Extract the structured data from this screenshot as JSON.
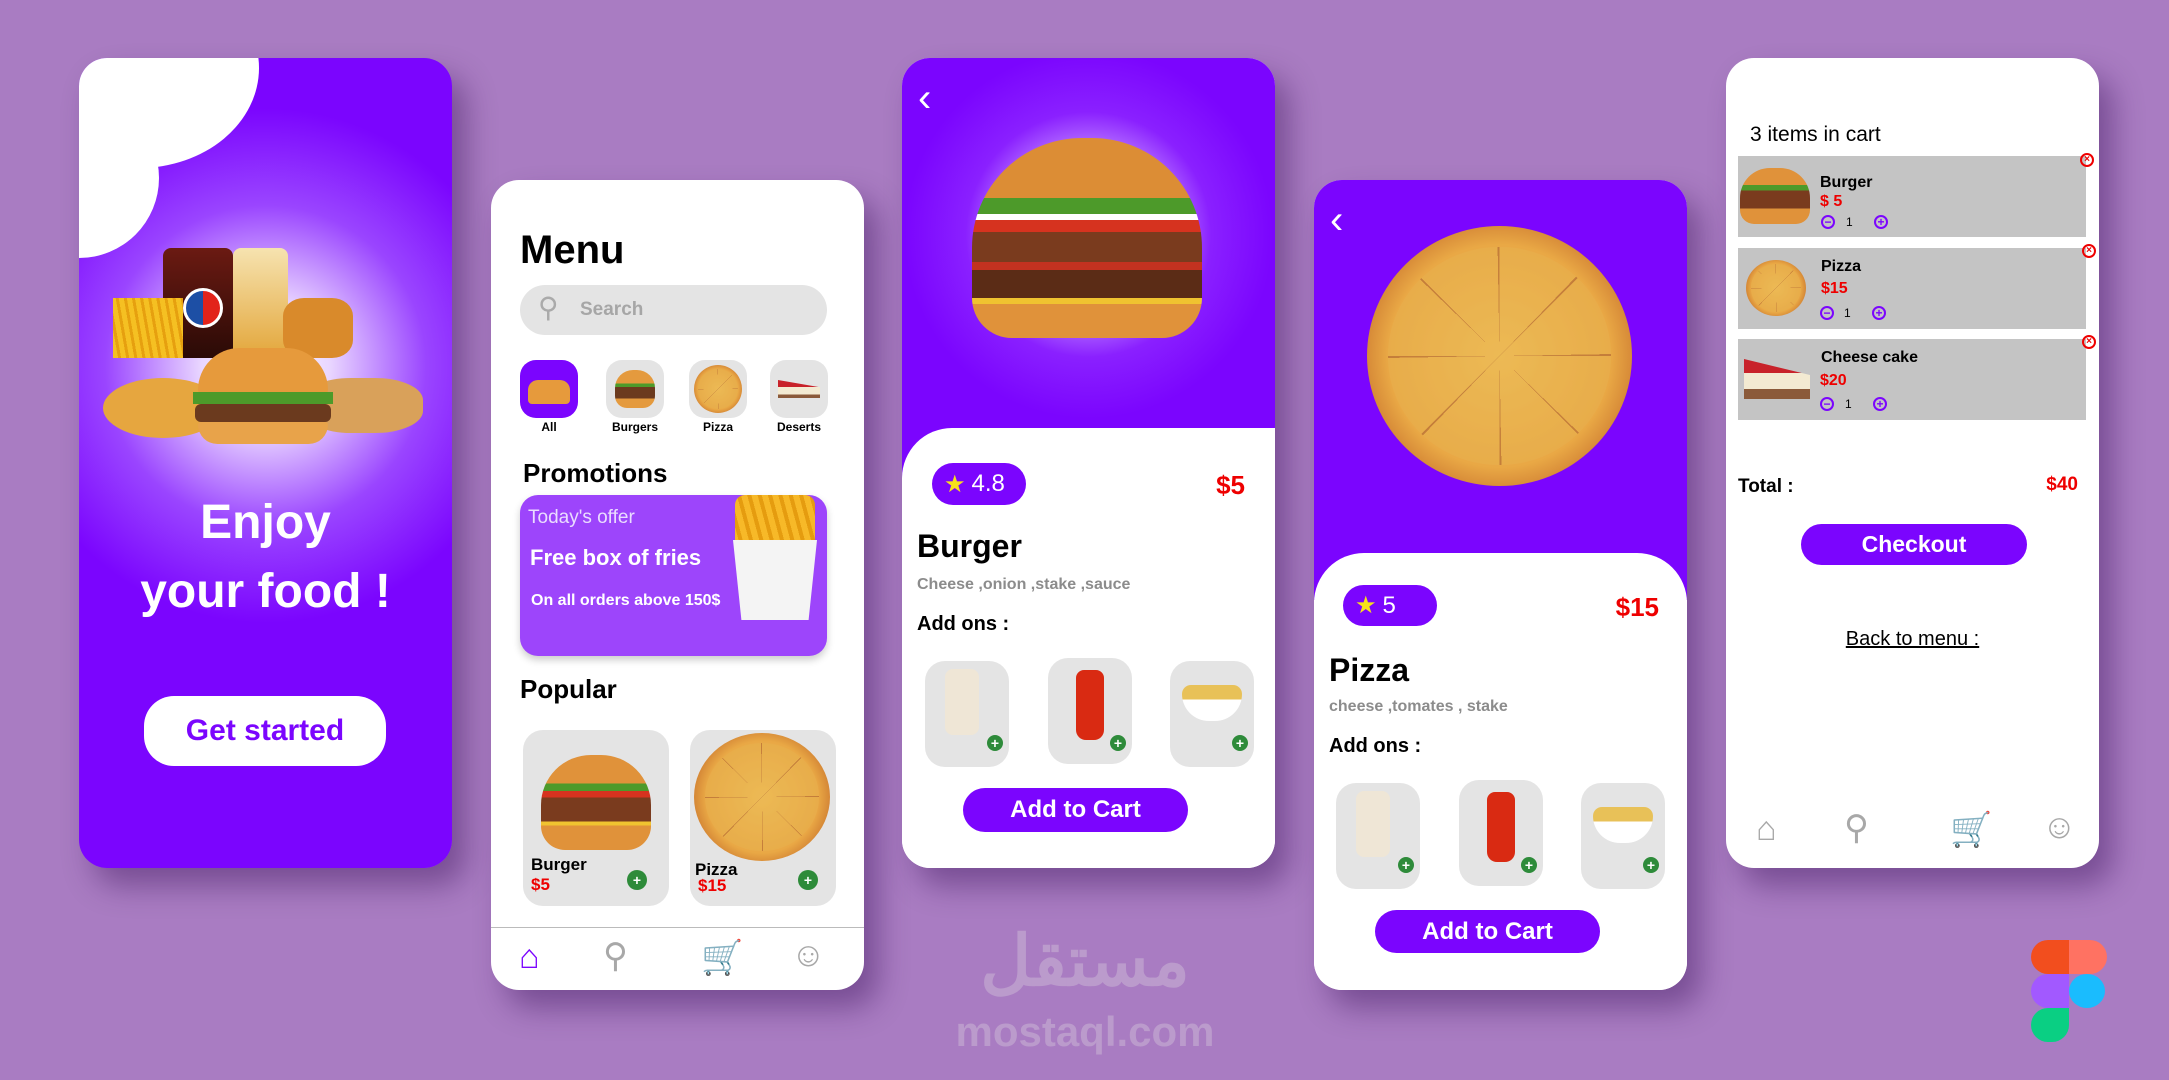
{
  "colors": {
    "background": "#a97cc2",
    "accent": "#7b05fe",
    "price": "#ee0000",
    "add": "#2e8b3a"
  },
  "welcome": {
    "title_line1": "Enjoy",
    "title_line2": "your food !",
    "button": "Get started"
  },
  "menu": {
    "title": "Menu",
    "search_placeholder": "Search",
    "categories": [
      {
        "label": "All"
      },
      {
        "label": "Burgers"
      },
      {
        "label": "Pizza"
      },
      {
        "label": "Deserts"
      }
    ],
    "promotions_title": "Promotions",
    "promo": {
      "kicker": "Today's offer",
      "headline": "Free box of fries",
      "detail": "On all orders above 150$"
    },
    "popular_title": "Popular",
    "popular": [
      {
        "name": "Burger",
        "price": "$5"
      },
      {
        "name": "Pizza",
        "price": "$15"
      }
    ],
    "nav": [
      {
        "icon": "home-icon",
        "active": true
      },
      {
        "icon": "search-icon"
      },
      {
        "icon": "cart-icon"
      },
      {
        "icon": "profile-icon"
      }
    ]
  },
  "burger_detail": {
    "rating": "4.8",
    "price": "$5",
    "name": "Burger",
    "ingredients": "Cheese ,onion ,stake ,sauce",
    "addons_title": "Add ons :",
    "button": "Add to Cart"
  },
  "pizza_detail": {
    "rating": "5",
    "price": "$15",
    "name": "Pizza",
    "ingredients": "cheese ,tomates , stake",
    "addons_title": "Add ons :",
    "button": "Add to Cart"
  },
  "cart": {
    "title": "3 items in cart",
    "items": [
      {
        "name": "Burger",
        "price": "$ 5",
        "qty": "1"
      },
      {
        "name": "Pizza",
        "price": "$15",
        "qty": "1"
      },
      {
        "name": "Cheese cake",
        "price": "$20",
        "qty": "1"
      }
    ],
    "total_label": "Total :",
    "total_value": "$40",
    "checkout": "Checkout",
    "back": "Back to menu :",
    "nav": [
      {
        "icon": "home-icon"
      },
      {
        "icon": "search-icon"
      },
      {
        "icon": "cart-icon",
        "active": true
      },
      {
        "icon": "profile-icon"
      }
    ]
  },
  "watermark": {
    "text": "mostaql.com",
    "arabic": "مستقل"
  }
}
